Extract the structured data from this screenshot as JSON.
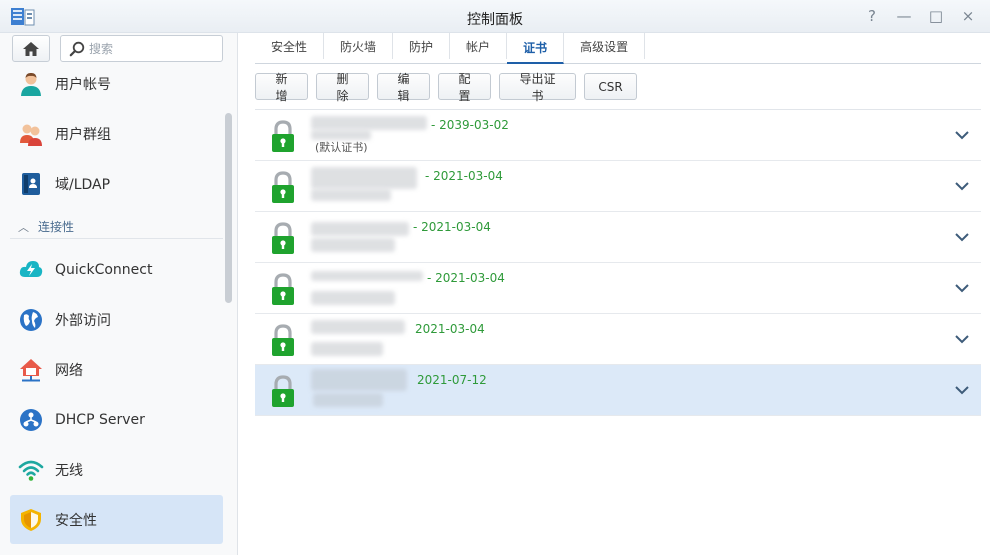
{
  "window": {
    "title": "控制面板",
    "controls": [
      "?",
      "—",
      "□",
      "×"
    ]
  },
  "sidebar": {
    "search_placeholder": "搜索",
    "items": [
      {
        "label": "用户帐号",
        "icon": "user-icon"
      },
      {
        "label": "用户群组",
        "icon": "user-group-icon"
      },
      {
        "label": "域/LDAP",
        "icon": "directory-icon"
      },
      {
        "label": "QuickConnect",
        "icon": "quickconnect-icon"
      },
      {
        "label": "外部访问",
        "icon": "globe-icon"
      },
      {
        "label": "网络",
        "icon": "network-house-icon"
      },
      {
        "label": "DHCP Server",
        "icon": "dhcp-icon"
      },
      {
        "label": "无线",
        "icon": "wifi-icon"
      },
      {
        "label": "安全性",
        "icon": "shield-icon"
      }
    ],
    "section_label": "连接性"
  },
  "tabs": [
    {
      "label": "安全性"
    },
    {
      "label": "防火墙"
    },
    {
      "label": "防护"
    },
    {
      "label": "帐户"
    },
    {
      "label": "证书"
    },
    {
      "label": "高级设置"
    }
  ],
  "toolbar": {
    "add": "新增",
    "delete": "删除",
    "edit": "编辑",
    "configure": "配置",
    "export": "导出证书",
    "csr": "CSR"
  },
  "certificates": [
    {
      "date": "- 2039-03-02",
      "sub": "(默认证书)"
    },
    {
      "date": "- 2021-03-04"
    },
    {
      "date": "- 2021-03-04"
    },
    {
      "date": "- 2021-03-04"
    },
    {
      "date": "2021-03-04"
    },
    {
      "date": "2021-07-12"
    }
  ],
  "colors": {
    "accent": "#1e5fa8",
    "date_green": "#2f9a3a",
    "lock_green": "#1fa32e",
    "selected_row": "#dce9f8",
    "active_nav": "#d6e5f7"
  }
}
